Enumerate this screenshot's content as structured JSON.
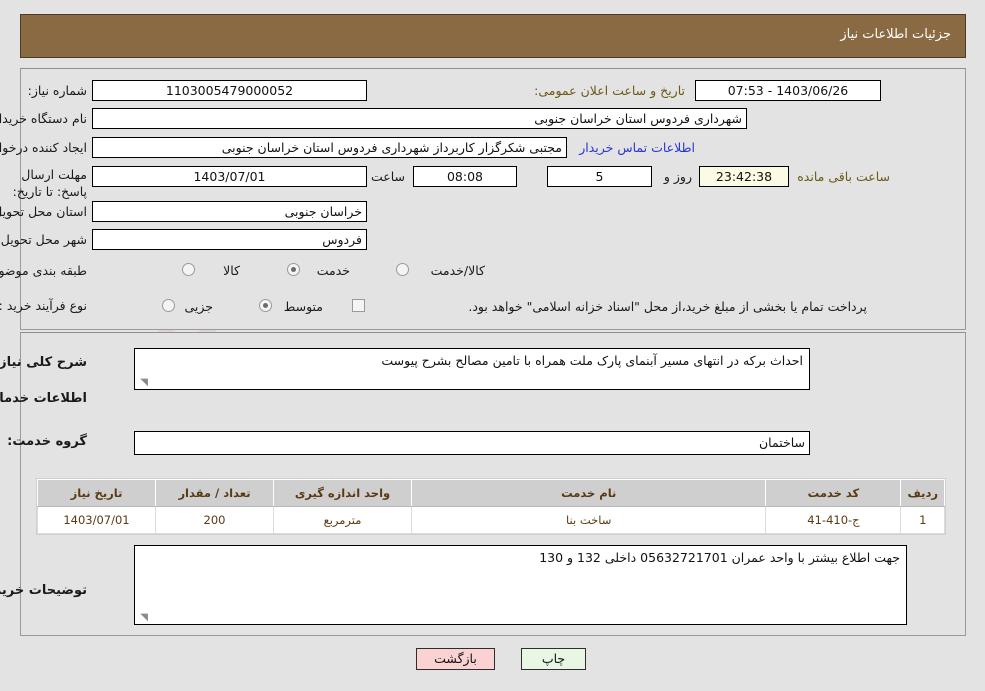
{
  "header": {
    "title": "جزئیات اطلاعات نیاز"
  },
  "form": {
    "need_number_label": "شماره نیاز:",
    "need_number_value": "1103005479000052",
    "announce_label": "تاریخ و ساعت اعلان عمومی:",
    "announce_value": "1403/06/26 - 07:53",
    "buyer_org_label": "نام دستگاه خریدار:",
    "buyer_org_value": "شهرداری فردوس استان خراسان جنوبی",
    "creator_label": "ایجاد کننده درخواست:",
    "creator_value": "مجتبی شکرگزار کاربرداز شهرداری فردوس استان خراسان جنوبی",
    "contact_link": "اطلاعات تماس خریدار",
    "deadline_label": "مهلت ارسال پاسخ: تا تاریخ:",
    "deadline_date": "1403/07/01",
    "hour_label": "ساعت",
    "deadline_time": "08:08",
    "days_remaining": "5",
    "days_label": "روز و",
    "countdown": "23:42:38",
    "remaining_label": "ساعت باقی مانده",
    "province_label": "استان محل تحویل:",
    "province_value": "خراسان جنوبی",
    "city_label": "شهر محل تحویل:",
    "city_value": "فردوس",
    "category_label": "طبقه بندی موضوعی:",
    "category_options": [
      "کالا",
      "خدمت",
      "کالا/خدمت"
    ],
    "category_selected": "خدمت",
    "process_label": "نوع فرآیند خرید :",
    "process_options": [
      "جزیی",
      "متوسط"
    ],
    "process_selected": "متوسط",
    "treasury_note": "پرداخت تمام یا بخشی از مبلغ خرید،از محل \"اسناد خزانه اسلامی\" خواهد بود."
  },
  "description": {
    "label": "شرح کلی نیاز:",
    "value": "احداث برکه در انتهای مسیر آبنمای پارک ملت همراه با تامین مصالح بشرح پیوست"
  },
  "services": {
    "section_title": "اطلاعات خدمات مورد نیاز",
    "group_label": "گروه خدمت:",
    "group_value": "ساختمان",
    "columns": [
      "ردیف",
      "کد خدمت",
      "نام خدمت",
      "واحد اندازه گیری",
      "تعداد / مقدار",
      "تاریخ نیاز"
    ],
    "rows": [
      {
        "row": "1",
        "code": "ج-410-41",
        "name": "ساخت بنا",
        "unit": "مترمربع",
        "qty": "200",
        "date": "1403/07/01"
      }
    ]
  },
  "buyer_notes": {
    "label": "توضیحات خریدار:",
    "value": "جهت اطلاع بیشتر با واحد عمران 05632721701 داخلی 132 و 130"
  },
  "buttons": {
    "print": "چاپ",
    "back": "بازگشت"
  },
  "watermark": {
    "text": "AriaTender.net"
  },
  "colors": {
    "header_bg": "#8a6a43",
    "panel_bg": "#e3e3e3",
    "link": "#2b35d0",
    "brown_text": "#6b5a18",
    "table_header_bg": "#cfcfcf",
    "table_text": "#5a3a12",
    "print_btn": "#e8f6e4",
    "back_btn": "#fbd2d2",
    "countdown_bg": "#fbfbe4"
  }
}
